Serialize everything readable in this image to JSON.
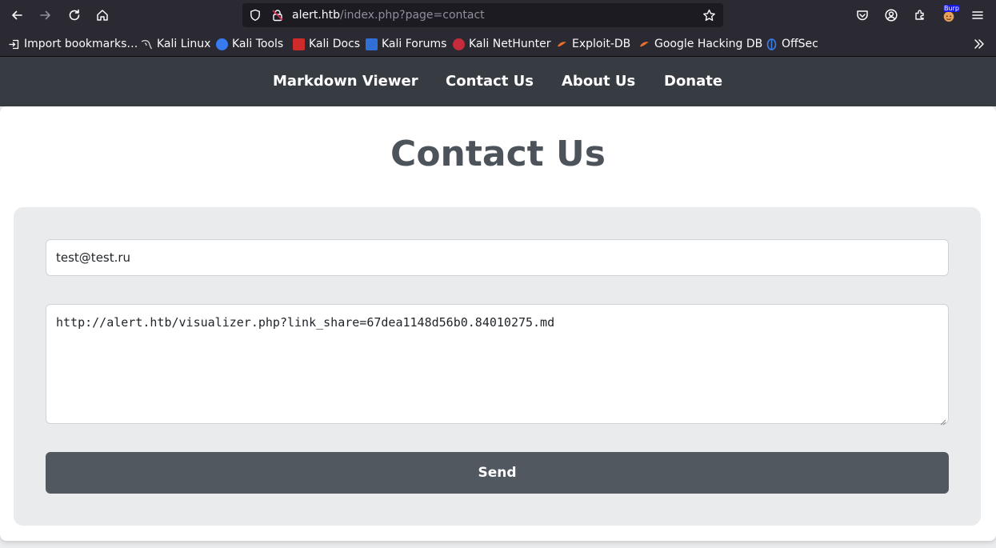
{
  "browser": {
    "url_host": "alert.htb",
    "url_path": "/index.php?page=contact",
    "extension_badge": "Burp",
    "icons": [
      "back-icon",
      "forward-icon",
      "reload-icon",
      "home-icon",
      "shield-icon",
      "lock-icon",
      "star-icon",
      "pocket-icon",
      "account-icon",
      "extensions-icon",
      "menu-icon"
    ]
  },
  "bookmarks": [
    {
      "label": "Import bookmarks…",
      "icon": "import-icon",
      "color": "#fbfbfe"
    },
    {
      "label": "Kali Linux",
      "icon": "kali-linux-icon",
      "color": "#1a1a1a"
    },
    {
      "label": "Kali Tools",
      "icon": "kali-tools-icon",
      "color": "#367bf0"
    },
    {
      "label": "Kali Docs",
      "icon": "kali-docs-icon",
      "color": "#d02b2b"
    },
    {
      "label": "Kali Forums",
      "icon": "kali-forums-icon",
      "color": "#2f6fd6"
    },
    {
      "label": "Kali NetHunter",
      "icon": "kali-nethunter-icon",
      "color": "#c52b3a"
    },
    {
      "label": "Exploit-DB",
      "icon": "exploit-db-icon",
      "color": "#e8702a"
    },
    {
      "label": "Google Hacking DB",
      "icon": "ghdb-icon",
      "color": "#e8702a"
    },
    {
      "label": "OffSec",
      "icon": "offsec-icon",
      "color": "#3a7ce8"
    }
  ],
  "nav": {
    "items": [
      "Markdown Viewer",
      "Contact Us",
      "About Us",
      "Donate"
    ]
  },
  "main": {
    "title": "Contact Us",
    "email_value": "test@test.ru",
    "message_value": "http://alert.htb/visualizer.php?link_share=67dea1148d56b0.84010275.md",
    "send_label": "Send"
  },
  "colors": {
    "nav_bg": "#373c43",
    "button_bg": "#525860",
    "title": "#4d535b"
  }
}
